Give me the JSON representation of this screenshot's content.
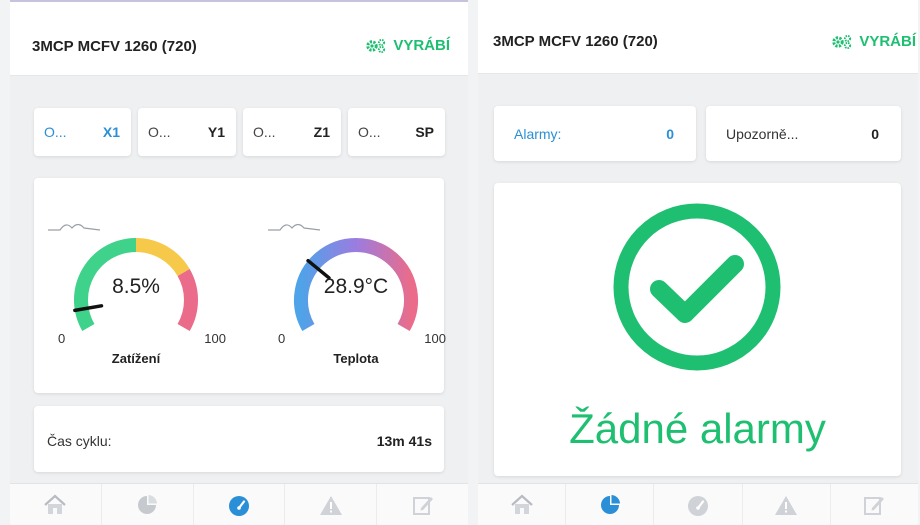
{
  "colors": {
    "accent_green": "#1fbf72",
    "accent_blue": "#2a8fd6",
    "gauge_red": "#ea6c8a",
    "gauge_yellow": "#f7c94b"
  },
  "left": {
    "header": {
      "title": "3MCP MCFV 1260 (720)",
      "status": "VYRÁBÍ",
      "status_icon": "gears-icon"
    },
    "axes": [
      {
        "label": "O...",
        "value": "X1",
        "highlighted": true
      },
      {
        "label": "O...",
        "value": "Y1",
        "highlighted": false
      },
      {
        "label": "O...",
        "value": "Z1",
        "highlighted": false
      },
      {
        "label": "O...",
        "value": "SP",
        "highlighted": false
      }
    ],
    "gauges": [
      {
        "value_text": "8.5%",
        "value": 8.5,
        "min": "0",
        "max": "100",
        "label": "Zatížení",
        "style": "segmented"
      },
      {
        "value_text": "28.9°C",
        "value": 28.9,
        "min": "0",
        "max": "100",
        "label": "Teplota",
        "style": "gradient"
      }
    ],
    "cycle": {
      "label": "Čas cyklu:",
      "value": "13m 41s"
    },
    "nav": [
      {
        "icon": "home-icon",
        "active": false
      },
      {
        "icon": "pie-chart-icon",
        "active": false
      },
      {
        "icon": "speedometer-icon",
        "active": true
      },
      {
        "icon": "warning-icon",
        "active": false
      },
      {
        "icon": "edit-icon",
        "active": false
      }
    ]
  },
  "right": {
    "header": {
      "title": "3MCP MCFV 1260 (720)",
      "status": "VYRÁBÍ",
      "status_icon": "gears-icon"
    },
    "alarms": {
      "label": "Alarmy:",
      "value": "0"
    },
    "warnings": {
      "label": "Upozorně...",
      "value": "0"
    },
    "ok": {
      "icon": "check-circle-icon",
      "text": "Žádné alarmy"
    },
    "nav": [
      {
        "icon": "home-icon",
        "active": false
      },
      {
        "icon": "pie-chart-icon",
        "active": true
      },
      {
        "icon": "speedometer-icon",
        "active": false
      },
      {
        "icon": "warning-icon",
        "active": false
      },
      {
        "icon": "edit-icon",
        "active": false
      }
    ]
  }
}
